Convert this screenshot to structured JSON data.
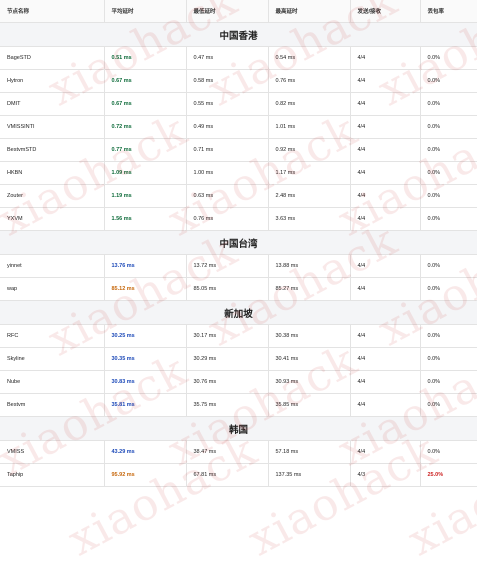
{
  "headers": [
    "节点名称",
    "平均延时",
    "最低延时",
    "最高延时",
    "发送/接收",
    "丢包率"
  ],
  "watermark": "xiaohack",
  "sections": [
    {
      "title": "中国香港",
      "rows": [
        {
          "name": "BageSTD",
          "avg": "0.51 ms",
          "min": "0.47 ms",
          "max": "0.54 ms",
          "sent": "4/4",
          "loss": "0.0%",
          "avg_color": "green"
        },
        {
          "name": "Hytron",
          "avg": "0.67 ms",
          "min": "0.58 ms",
          "max": "0.76 ms",
          "sent": "4/4",
          "loss": "0.0%",
          "avg_color": "green"
        },
        {
          "name": "DMIT",
          "avg": "0.67 ms",
          "min": "0.55 ms",
          "max": "0.82 ms",
          "sent": "4/4",
          "loss": "0.0%",
          "avg_color": "green"
        },
        {
          "name": "VMISSINTI",
          "avg": "0.72 ms",
          "min": "0.49 ms",
          "max": "1.01 ms",
          "sent": "4/4",
          "loss": "0.0%",
          "avg_color": "green"
        },
        {
          "name": "BestvmSTD",
          "avg": "0.77 ms",
          "min": "0.71 ms",
          "max": "0.92 ms",
          "sent": "4/4",
          "loss": "0.0%",
          "avg_color": "green"
        },
        {
          "name": "HKBN",
          "avg": "1.09 ms",
          "min": "1.00 ms",
          "max": "1.17 ms",
          "sent": "4/4",
          "loss": "0.0%",
          "avg_color": "green"
        },
        {
          "name": "Zouter",
          "avg": "1.19 ms",
          "min": "0.63 ms",
          "max": "2.48 ms",
          "sent": "4/4",
          "loss": "0.0%",
          "avg_color": "green"
        },
        {
          "name": "YXVM",
          "avg": "1.56 ms",
          "min": "0.76 ms",
          "max": "3.63 ms",
          "sent": "4/4",
          "loss": "0.0%",
          "avg_color": "green"
        }
      ]
    },
    {
      "title": "中国台湾",
      "rows": [
        {
          "name": "yinnet",
          "avg": "13.76 ms",
          "min": "13.72 ms",
          "max": "13.88 ms",
          "sent": "4/4",
          "loss": "0.0%",
          "avg_color": "blue"
        },
        {
          "name": "wap",
          "avg": "85.12 ms",
          "min": "85.05 ms",
          "max": "85.27 ms",
          "sent": "4/4",
          "loss": "0.0%",
          "avg_color": "orange"
        }
      ]
    },
    {
      "title": "新加坡",
      "rows": [
        {
          "name": "RFC",
          "avg": "30.25 ms",
          "min": "30.17 ms",
          "max": "30.38 ms",
          "sent": "4/4",
          "loss": "0.0%",
          "avg_color": "blue"
        },
        {
          "name": "Skyline",
          "avg": "30.35 ms",
          "min": "30.29 ms",
          "max": "30.41 ms",
          "sent": "4/4",
          "loss": "0.0%",
          "avg_color": "blue"
        },
        {
          "name": "Nube",
          "avg": "30.83 ms",
          "min": "30.76 ms",
          "max": "30.93 ms",
          "sent": "4/4",
          "loss": "0.0%",
          "avg_color": "blue"
        },
        {
          "name": "Bestvm",
          "avg": "35.81 ms",
          "min": "35.75 ms",
          "max": "35.85 ms",
          "sent": "4/4",
          "loss": "0.0%",
          "avg_color": "blue"
        }
      ]
    },
    {
      "title": "韩国",
      "rows": [
        {
          "name": "VMISS",
          "avg": "43.29 ms",
          "min": "38.47 ms",
          "max": "57.18 ms",
          "sent": "4/4",
          "loss": "0.0%",
          "avg_color": "blue"
        },
        {
          "name": "Taphip",
          "avg": "95.92 ms",
          "min": "67.81 ms",
          "max": "137.35 ms",
          "sent": "4/3",
          "loss": "25.0%",
          "avg_color": "orange",
          "loss_color": "red"
        }
      ]
    }
  ],
  "colors": {
    "green": "#0e6b3a",
    "blue": "#1c49b8",
    "orange": "#c7690e",
    "red": "#cc2222"
  }
}
